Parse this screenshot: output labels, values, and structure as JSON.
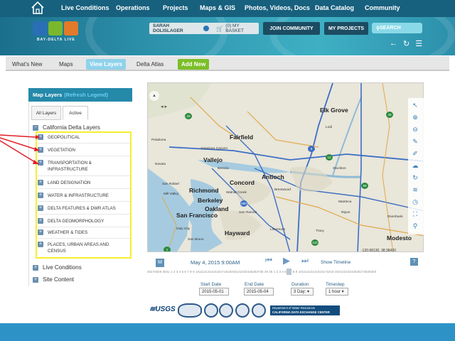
{
  "nav": {
    "items": [
      "Live Conditions",
      "Operations",
      "Projects",
      "Maps & GIS",
      "Photos, Videos, Docs",
      "Data Catalog",
      "Community"
    ]
  },
  "banner": {
    "logo_text": "BAY-DELTA LIVE",
    "user_name": "SARAH DOLISLAGER",
    "basket": "(0) MY BASKET",
    "join": "JOIN COMMUNITY",
    "my_projects": "MY PROJECTS",
    "search_placeholder": "SEARCH"
  },
  "tabs": [
    "What's New",
    "Maps",
    "View Layers",
    "Delta Atlas",
    "Add New"
  ],
  "panel": {
    "title": "Map Layers",
    "refresh": "(Refresh Legend)",
    "tab_all": "All Layers",
    "tab_active": "Active",
    "root": "California Delta Layers",
    "layers": [
      "GEOPOLITICAL",
      "VEGETATION",
      "TRANSPORTATION & INFRASTRUCTURE",
      "LAND DESIGNATION",
      "WATER & INFRASTRUCTURE",
      "DELTA FEATURES & DWR ATLAS",
      "DELTA GEOMORPHOLOGY",
      "WEATHER & TIDES",
      "PLACES, URBAN AREAS AND CENSUS"
    ],
    "live_conditions": "Live Conditions",
    "site_content": "Site Content"
  },
  "map": {
    "places": {
      "elk_grove": "Elk Grove",
      "fairfield": "Fairfield",
      "american_canyon": "American Canyon",
      "vallejo": "Vallejo",
      "petaluma": "Petaluma",
      "benicia": "Benicia",
      "concord": "Concord",
      "antioch": "Antioch",
      "brentwood": "Brentwood",
      "richmond": "Richmond",
      "san_rafael": "San Rafael",
      "berkeley": "Berkeley",
      "mill_valley": "Mill Valley",
      "oakland": "Oakland",
      "walnut_creek": "Walnut Creek",
      "san_francisco": "San Francisco",
      "san_ramon": "San Ramon",
      "daly_city": "Daly City",
      "hayward": "Hayward",
      "livermore": "Livermore",
      "tracy": "Tracy",
      "modesto": "Modesto",
      "san_bruno": "San Bruno",
      "riverbank": "Riverbank",
      "ripon": "Ripon",
      "manteca": "Manteca",
      "lodi": "Lodi",
      "stockton": "Stockton",
      "novato": "Novato"
    },
    "shields": [
      "29",
      "49",
      "680",
      "5",
      "12",
      "99",
      "132",
      "1"
    ],
    "coords": "-120.68130, 38.38420"
  },
  "timeline": {
    "m_label": "M",
    "date": "May 4, 2015 9:00AM",
    "show": "Show Timeline",
    "help": "?",
    "ticks": "26272829 3031 1  2  3  4  5  6  7  8  9 10111213141516171819202122232425262728 29 30  1  2  3  4  5  6  7  8  9 10111213141516171819 20212223242526272829303",
    "start_label": "Start Date",
    "start_value": "2015-05-01",
    "end_label": "End Date",
    "end_value": "2015-05-04",
    "duration_label": "Duration",
    "duration_value": "3 Day: ▾",
    "timestep_label": "Timestep",
    "timestep_value": "1 hour ▾"
  },
  "logos": {
    "usgs": "≋USGS",
    "dwr_line1": "Department of Water Resources",
    "dwr_line2": "CALIFORNIA DATA EXCHANGE CENTER"
  }
}
